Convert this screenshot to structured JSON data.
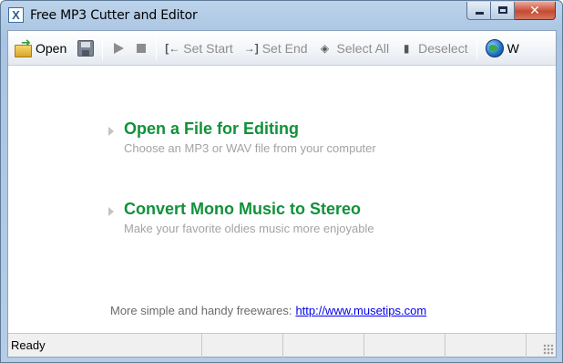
{
  "window": {
    "title": "Free MP3 Cutter and Editor",
    "app_icon_glyph": "X",
    "buttons": {
      "minimize_icon": "minimize-icon",
      "maximize_icon": "maximize-icon",
      "close_glyph": "✕"
    }
  },
  "toolbar": {
    "open_label": "Open",
    "set_start_label": "Set Start",
    "set_end_label": "Set End",
    "select_all_label": "Select All",
    "deselect_label": "Deselect",
    "website_label": "W",
    "set_start_glyph": "[←",
    "set_end_glyph": "→]",
    "select_all_glyph": "◈",
    "deselect_glyph": "▮"
  },
  "main": {
    "actions": [
      {
        "title": "Open a File for Editing",
        "subtitle": "Choose an MP3 or WAV file from your computer"
      },
      {
        "title": "Convert Mono Music to Stereo",
        "subtitle": "Make your favorite oldies music more enjoyable"
      }
    ],
    "footer_text": "More simple and handy freewares:",
    "footer_link": "http://www.musetips.com"
  },
  "status": {
    "text": "Ready"
  },
  "colors": {
    "action_title": "#11913a",
    "action_subtitle": "#a3a3a3",
    "link": "#0000ee"
  }
}
